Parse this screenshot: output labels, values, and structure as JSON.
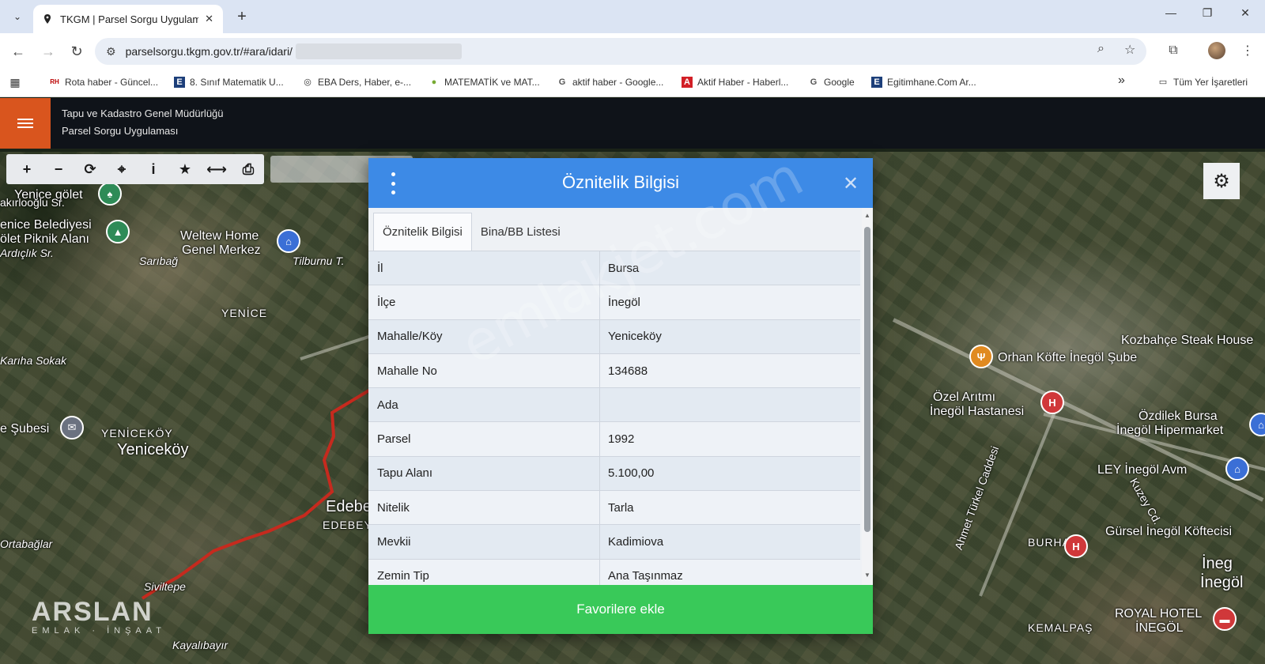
{
  "browser": {
    "tab_title": "TKGM | Parsel Sorgu Uygulaması",
    "tab_close": "✕",
    "new_tab": "+",
    "url": "parselsorgu.tkgm.gov.tr/#ara/idari/",
    "window_controls": [
      "—",
      "❐",
      "✕"
    ],
    "bookmarks": [
      {
        "label": "Rota haber - Güncel...",
        "icon": "RH"
      },
      {
        "label": "8. Sınıf Matematik U...",
        "icon": "E"
      },
      {
        "label": "EBA Ders, Haber, e-...",
        "icon": "◎"
      },
      {
        "label": "MATEMATİK ve MAT...",
        "icon": "●"
      },
      {
        "label": "aktif haber - Google...",
        "icon": "G"
      },
      {
        "label": "Aktif Haber - Haberl...",
        "icon": "A"
      },
      {
        "label": "Google",
        "icon": "G"
      },
      {
        "label": "Egitimhane.Com Ar...",
        "icon": "E"
      }
    ],
    "bookmarks_overflow": "»",
    "all_bookmarks": "Tüm Yer İşaretleri"
  },
  "app": {
    "org_name": "Tapu ve Kadastro Genel Müdürlüğü",
    "app_name": "Parsel Sorgu Uygulaması"
  },
  "map": {
    "labels": [
      {
        "text": "Yenice gölet"
      },
      {
        "text": "akırlooğlu Sr."
      },
      {
        "text": "enice Belediyesi"
      },
      {
        "text": "ölet Piknik Alanı"
      },
      {
        "text": "Ardıçlık Sr."
      },
      {
        "text": "Weltew Home"
      },
      {
        "text": "Genel Merkez"
      },
      {
        "text": "Sarıbağ"
      },
      {
        "text": "Tilburnu T."
      },
      {
        "text": "YENİCE"
      },
      {
        "text": "Karıha Sokak"
      },
      {
        "text": "e Şubesi"
      },
      {
        "text": "YENİCEKÖY"
      },
      {
        "text": "Yeniceköy"
      },
      {
        "text": "Edebe"
      },
      {
        "text": "EDEBEY"
      },
      {
        "text": "Ortabağlar"
      },
      {
        "text": "Siviltepe"
      },
      {
        "text": "Kayalıbayır"
      },
      {
        "text": "Kozbahçe Steak House"
      },
      {
        "text": "Orhan Köfte İnegöl Şube"
      },
      {
        "text": "Özel Arıtmı"
      },
      {
        "text": "İnegöl Hastanesi"
      },
      {
        "text": "Özdilek Bursa"
      },
      {
        "text": "İnegöl Hipermarket"
      },
      {
        "text": "LEY İnegöl Avm"
      },
      {
        "text": "Gürsel İnegöl Köftecisi"
      },
      {
        "text": "BURHA"
      },
      {
        "text": "İnegöl"
      },
      {
        "text": "İneg"
      },
      {
        "text": "ROYAL HOTEL"
      },
      {
        "text": "İNEGÖL"
      },
      {
        "text": "KEMALPAŞ"
      },
      {
        "text": "Ahmet Türkel Caddesi"
      },
      {
        "text": "Kuzey Cd."
      }
    ],
    "logo": {
      "main": "ARSLAN",
      "sub": "EMLAK · İNŞAAT"
    },
    "watermark": "emlakjet.com"
  },
  "dialog": {
    "title": "Öznitelik Bilgisi",
    "close": "✕",
    "tabs": [
      {
        "label": "Öznitelik Bilgisi",
        "active": true
      },
      {
        "label": "Bina/BB Listesi",
        "active": false
      }
    ],
    "rows": [
      {
        "key": "İl",
        "value": "Bursa"
      },
      {
        "key": "İlçe",
        "value": "İnegöl"
      },
      {
        "key": "Mahalle/Köy",
        "value": "Yeniceköy"
      },
      {
        "key": "Mahalle No",
        "value": "134688"
      },
      {
        "key": "Ada",
        "value": ""
      },
      {
        "key": "Parsel",
        "value": "1992"
      },
      {
        "key": "Tapu Alanı",
        "value": "5.100,00"
      },
      {
        "key": "Nitelik",
        "value": "Tarla"
      },
      {
        "key": "Mevkii",
        "value": "Kadimiova"
      },
      {
        "key": "Zemin Tip",
        "value": "Ana Taşınmaz"
      }
    ],
    "footer_button": "Favorilere ekle"
  },
  "colors": {
    "header_blue": "#3d8ae6",
    "footer_green": "#39c959",
    "menu_orange": "#d9551e",
    "app_header_bg": "#0f1319"
  }
}
